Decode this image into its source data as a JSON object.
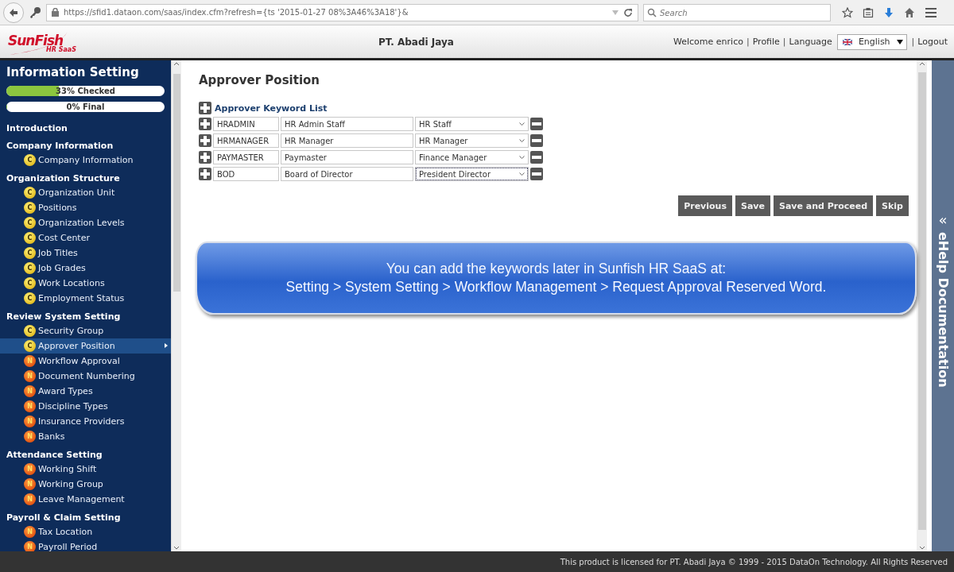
{
  "browser": {
    "url": "https://sfid1.dataon.com/saas/index.cfm?refresh={ts '2015-01-27 08%3A46%3A18'}&",
    "search": {
      "placeholder": "Search"
    }
  },
  "header": {
    "logo": {
      "name": "SunFish",
      "tagline": "HR SaaS"
    },
    "company": "PT. Abadi Jaya",
    "welcome": "Welcome enrico",
    "separator": "|",
    "links": [
      "Profile",
      "Language"
    ],
    "language": "English",
    "logout": "Logout"
  },
  "sidebar": {
    "title": "Information Setting",
    "progress": [
      {
        "label": "33% Checked",
        "level": 0.33
      },
      {
        "label": "0% Final",
        "level": 0
      }
    ],
    "sections": [
      {
        "title": "Introduction"
      },
      {
        "title": "Company Information",
        "items": [
          {
            "badge": "C",
            "kind": "complete",
            "label": "Company Information",
            "selected": false
          }
        ]
      },
      {
        "title": "Organization Structure",
        "items": [
          {
            "badge": "C",
            "kind": "complete",
            "label": "Organization Unit",
            "selected": false
          },
          {
            "badge": "C",
            "kind": "complete",
            "label": "Positions",
            "selected": false
          },
          {
            "badge": "C",
            "kind": "complete",
            "label": "Organization Levels",
            "selected": false
          },
          {
            "badge": "C",
            "kind": "complete",
            "label": "Cost Center",
            "selected": false
          },
          {
            "badge": "C",
            "kind": "complete",
            "label": "Job Titles",
            "selected": false
          },
          {
            "badge": "C",
            "kind": "complete",
            "label": "Job Grades",
            "selected": false
          },
          {
            "badge": "C",
            "kind": "complete",
            "label": "Work Locations",
            "selected": false
          },
          {
            "badge": "C",
            "kind": "complete",
            "label": "Employment Status",
            "selected": false
          }
        ]
      },
      {
        "title": "Review System Setting",
        "items": [
          {
            "badge": "C",
            "kind": "complete",
            "label": "Security Group",
            "selected": false
          },
          {
            "badge": "C",
            "kind": "complete",
            "label": "Approver Position",
            "selected": true
          },
          {
            "badge": "N",
            "kind": "new",
            "label": "Workflow Approval",
            "selected": false
          },
          {
            "badge": "N",
            "kind": "new",
            "label": "Document Numbering",
            "selected": false
          },
          {
            "badge": "N",
            "kind": "new",
            "label": "Award Types",
            "selected": false
          },
          {
            "badge": "N",
            "kind": "new",
            "label": "Discipline Types",
            "selected": false
          },
          {
            "badge": "N",
            "kind": "new",
            "label": "Insurance Providers",
            "selected": false
          },
          {
            "badge": "N",
            "kind": "new",
            "label": "Banks",
            "selected": false
          }
        ]
      },
      {
        "title": "Attendance Setting",
        "items": [
          {
            "badge": "N",
            "kind": "new",
            "label": "Working Shift",
            "selected": false
          },
          {
            "badge": "N",
            "kind": "new",
            "label": "Working Group",
            "selected": false
          },
          {
            "badge": "N",
            "kind": "new",
            "label": "Leave Management",
            "selected": false
          }
        ]
      },
      {
        "title": "Payroll & Claim Setting",
        "items": [
          {
            "badge": "N",
            "kind": "new",
            "label": "Tax Location",
            "selected": false
          },
          {
            "badge": "N",
            "kind": "new",
            "label": "Payroll Period",
            "selected": false
          }
        ]
      }
    ]
  },
  "main": {
    "title": "Approver Position",
    "list_title": "Approver Keyword List",
    "rows": [
      {
        "keyword": "HRADMIN",
        "description": "HR Admin Staff",
        "position": "HR Staff",
        "focused": false
      },
      {
        "keyword": "HRMANAGER",
        "description": "HR Manager",
        "position": "HR Manager",
        "focused": false
      },
      {
        "keyword": "PAYMASTER",
        "description": "Paymaster",
        "position": "Finance Manager",
        "focused": false
      },
      {
        "keyword": "BOD",
        "description": "Board of Director",
        "position": "President Director",
        "focused": true
      }
    ],
    "buttons": [
      "Previous",
      "Save",
      "Save and Proceed",
      "Skip"
    ],
    "callout": [
      "You can add the keywords later in Sunfish HR SaaS at:",
      "Setting > System Setting > Workflow Management > Request Approval Reserved Word."
    ]
  },
  "help_panel": {
    "arrow": "«",
    "label": "eHelp Documentation"
  },
  "footer": "This product is licensed for PT. Abadi Jaya © 1999 - 2015 DataOn Technology. All Rights Reserved"
}
